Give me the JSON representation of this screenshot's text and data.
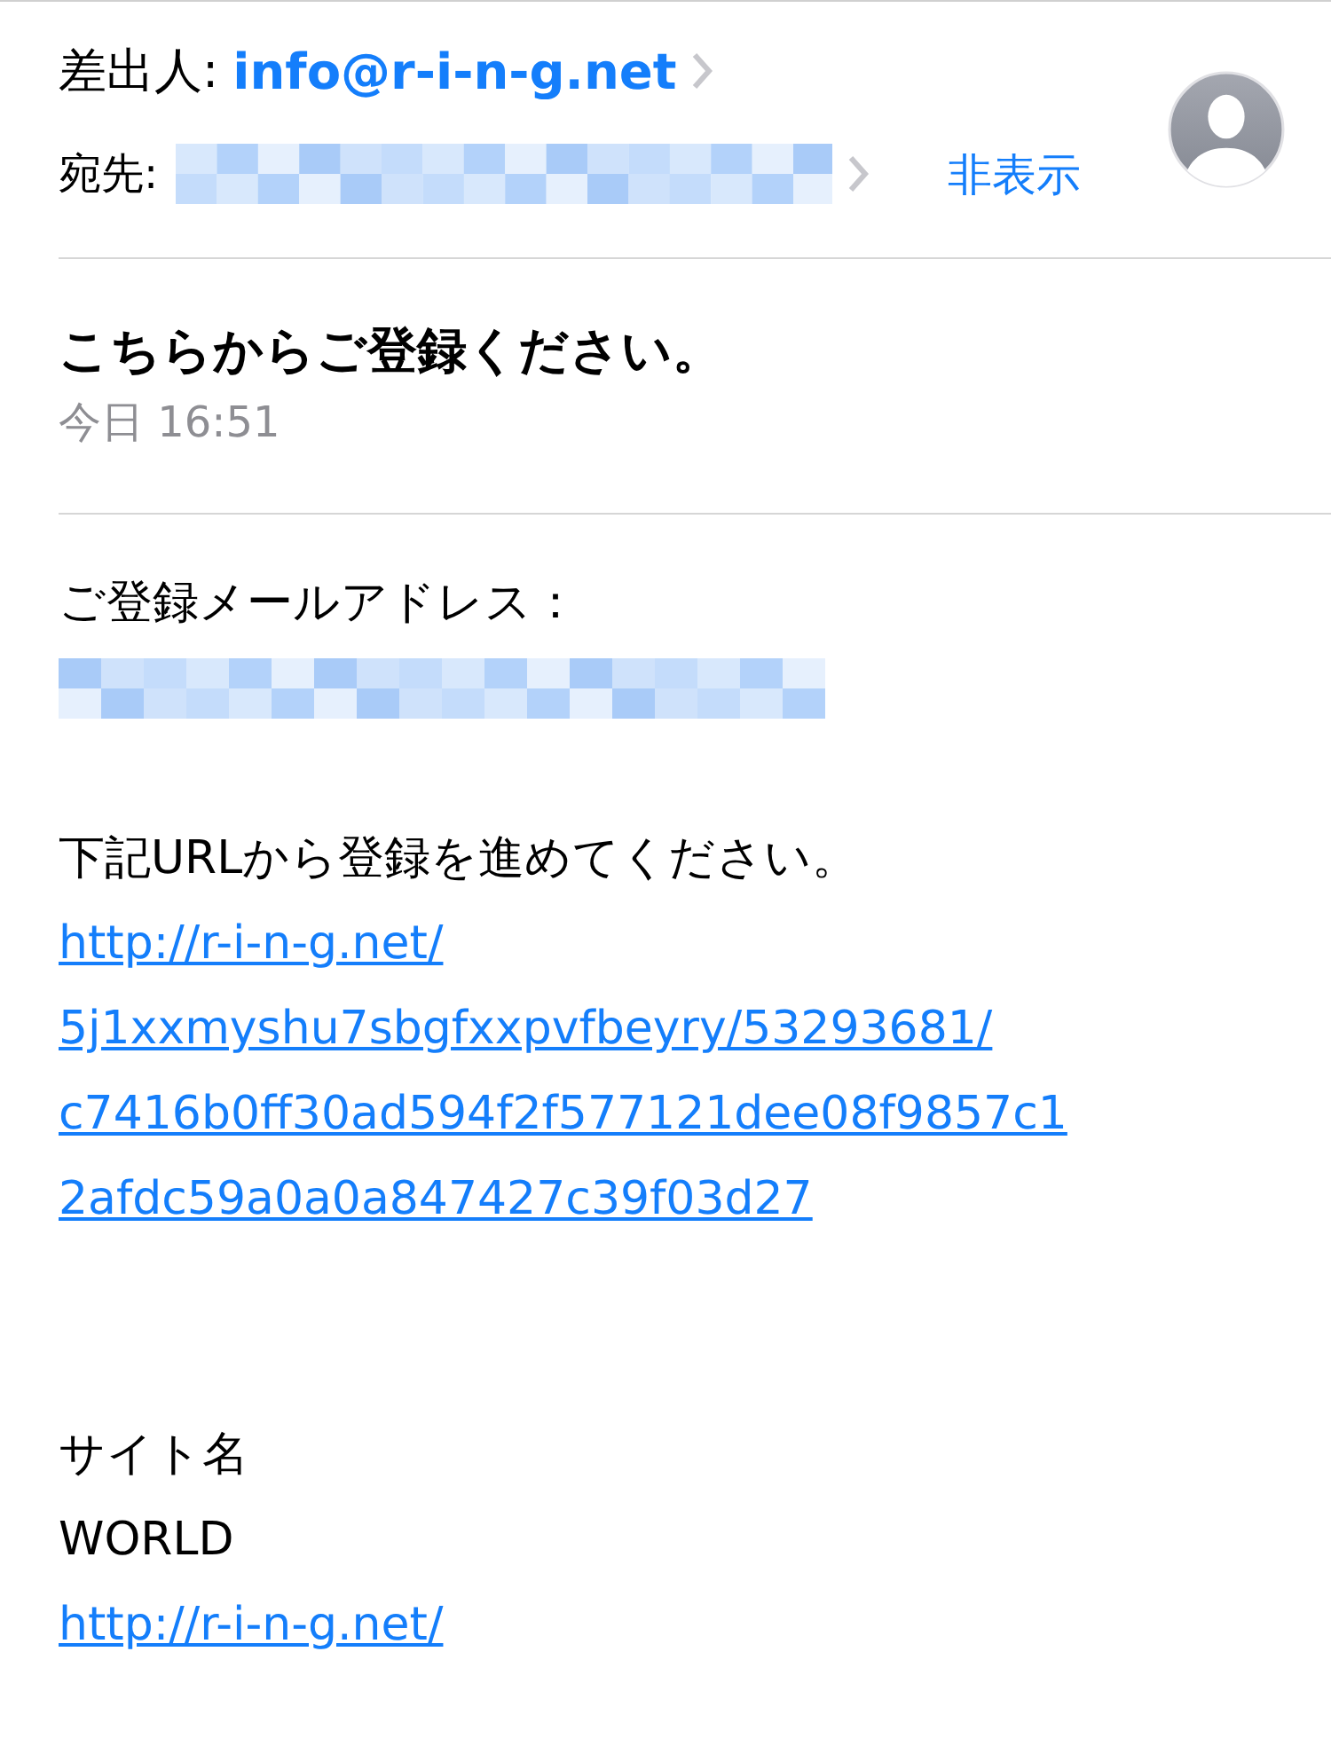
{
  "header": {
    "from_label": "差出人:",
    "from_address": "info@r-i-n-g.net",
    "to_label": "宛先:",
    "to": {
      "kind": "redacted"
    },
    "hide_link": "非表示"
  },
  "message": {
    "subject": "こちらからご登録ください。",
    "date": "今日 16:51"
  },
  "paragraphs": [
    [
      {
        "kind": "text",
        "text": "ご登録メールアドレス："
      },
      {
        "kind": "redacted"
      }
    ],
    [
      {
        "kind": "text",
        "text": "下記URLから登録を進めてください。"
      },
      {
        "kind": "link",
        "lines": [
          "http://r-i-n-g.net/",
          "5j1xxmyshu7sbgfxxpvfbeyry/53293681/",
          "c7416b0ff30ad594f2f577121dee08f9857c1",
          "2afdc59a0a0a847427c39f03d27"
        ]
      }
    ],
    [
      {
        "kind": "text",
        "text": "サイト名"
      },
      {
        "kind": "text",
        "text": "WORLD"
      },
      {
        "kind": "link",
        "lines": [
          "http://r-i-n-g.net/"
        ]
      }
    ]
  ]
}
